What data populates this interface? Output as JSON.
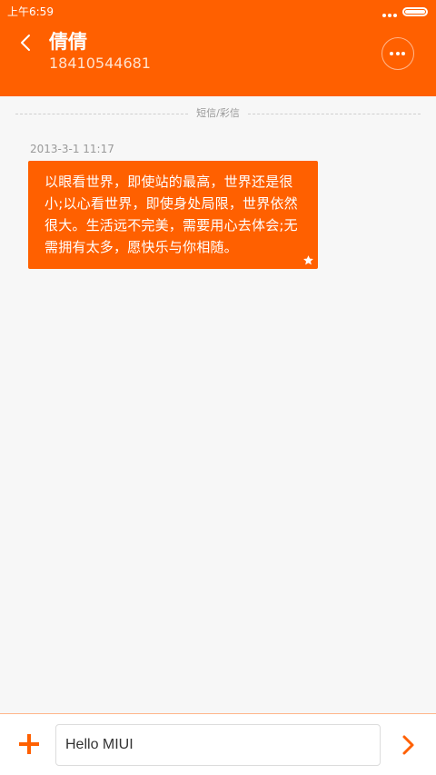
{
  "status_bar": {
    "time": "上午6:59"
  },
  "header": {
    "contact_name": "倩倩",
    "contact_number": "18410544681"
  },
  "conversation": {
    "divider_label": "短信/彩信",
    "messages": [
      {
        "timestamp": "2013-3-1 11:17",
        "text": "以眼看世界，即使站的最高，世界还是很小;以心看世界，即使身处局限，世界依然很大。生活远不完美，需要用心去体会;无需拥有太多，愿快乐与你相随。",
        "starred": true
      }
    ]
  },
  "composer": {
    "input_value": "Hello MIUI"
  },
  "icons": {
    "back": "chevron-left-icon",
    "more": "more-dots-icon",
    "star": "star-icon",
    "add": "plus-icon",
    "send": "chevron-right-icon",
    "battery": "battery-icon"
  },
  "colors": {
    "accent": "#ff6000",
    "background": "#f7f7f7",
    "bubble_text": "#ffffff"
  }
}
